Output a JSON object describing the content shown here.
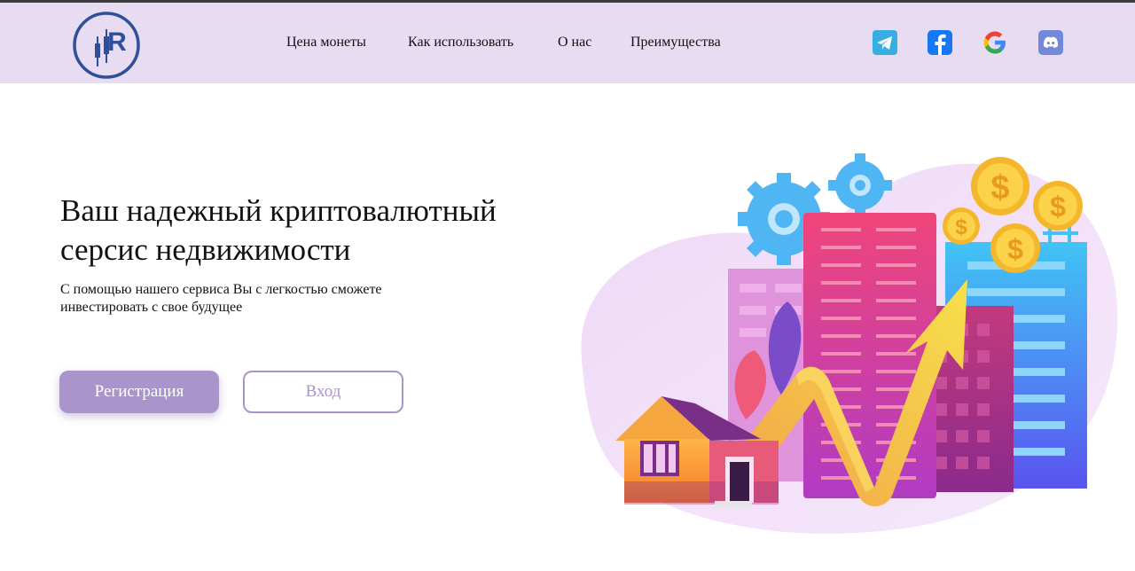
{
  "header": {
    "logo_text": "IIR",
    "nav": [
      {
        "label": "Цена монеты"
      },
      {
        "label": "Как использовать"
      },
      {
        "label": "О нас"
      },
      {
        "label": "Преимущества"
      }
    ],
    "social_icons": [
      "telegram-icon",
      "facebook-icon",
      "google-icon",
      "discord-icon"
    ]
  },
  "hero": {
    "title_line1": "Ваш надежный криптовалютный",
    "title_line2": "серсис недвижимости",
    "subtitle_line1": "С помощью нашего сервиса Вы с легкостью сможете",
    "subtitle_line2": "инвестировать с свое будущее",
    "register_label": "Регистрация",
    "login_label": "Вход"
  },
  "illustration": {
    "coin_symbol": "$"
  },
  "colors": {
    "header_bg": "#e7dcf1",
    "accent": "#a994cc",
    "logo": "#2f4f9a"
  }
}
